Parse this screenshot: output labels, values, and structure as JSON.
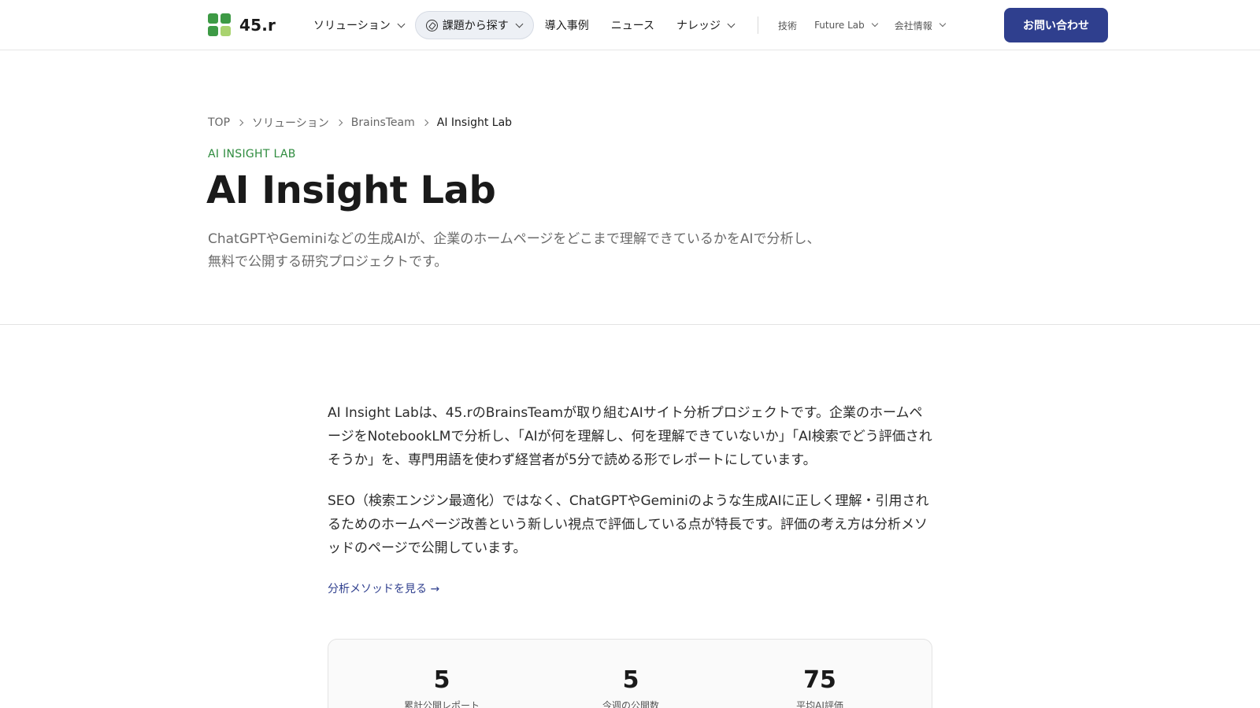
{
  "brand": {
    "name": "45.r"
  },
  "nav": {
    "items": [
      {
        "label": "ソリューション"
      },
      {
        "label": "課題から探す"
      },
      {
        "label": "導入事例"
      },
      {
        "label": "ニュース"
      },
      {
        "label": "ナレッジ"
      }
    ],
    "secondary": [
      {
        "label": "技術"
      },
      {
        "label": "Future Lab"
      },
      {
        "label": "会社情報"
      }
    ],
    "cta_label": "お問い合わせ"
  },
  "breadcrumb": [
    "TOP",
    "ソリューション",
    "BrainsTeam",
    "AI Insight Lab"
  ],
  "hero": {
    "eyebrow": "AI INSIGHT LAB",
    "title": "AI Insight Lab",
    "lead": "ChatGPTやGeminiなどの生成AIが、企業のホームページをどこまで理解できているかをAIで分析し、無料で公開する研究プロジェクトです。"
  },
  "content": {
    "paragraphs": [
      "AI Insight Labは、45.rのBrainsTeamが取り組むAIサイト分析プロジェクトです。企業のホームページをNotebookLMで分析し、「AIが何を理解し、何を理解できていないか」「AI検索でどう評価されそうか」を、専門用語を使わず経営者が5分で読める形でレポートにしています。",
      "SEO（検索エンジン最適化）ではなく、ChatGPTやGeminiのような生成AIに正しく理解・引用されるためのホームページ改善という新しい視点で評価している点が特長です。評価の考え方は分析メソッドのページで公開しています。"
    ],
    "method_link": "分析メソッドを見る →"
  },
  "stats": [
    {
      "value": "5",
      "label": "累計公開レポート"
    },
    {
      "value": "5",
      "label": "今週の公開数"
    },
    {
      "value": "75",
      "label": "平均AI評価"
    }
  ],
  "colors": {
    "accent_navy": "#2f3f8e",
    "accent_green": "#2e8b3e",
    "logo_light_green": "#a9d36f"
  }
}
